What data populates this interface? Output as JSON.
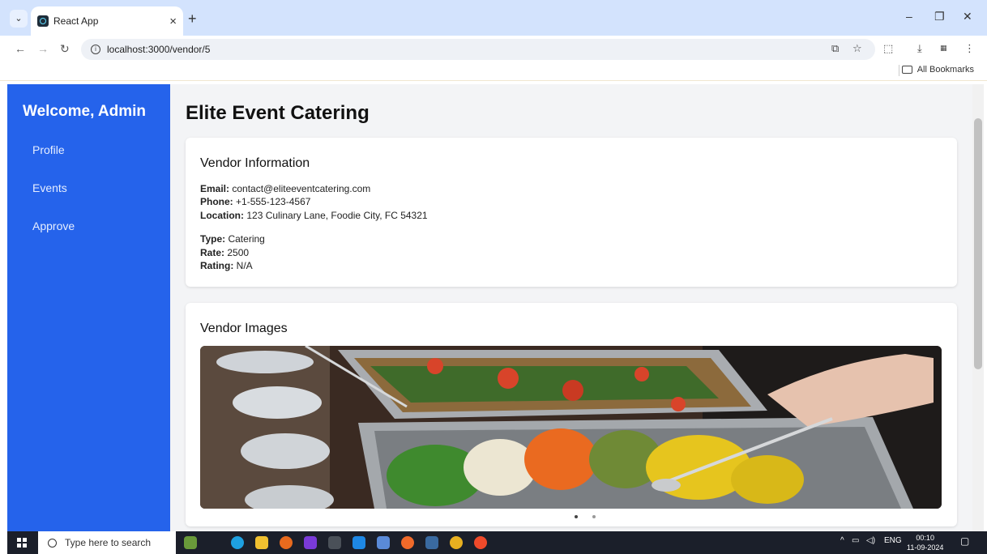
{
  "browser": {
    "tab_title": "React App",
    "url": "localhost:3000/vendor/5",
    "bookmarks_label": "All Bookmarks"
  },
  "sidebar": {
    "welcome": "Welcome, Admin",
    "items": [
      {
        "label": "Profile"
      },
      {
        "label": "Events"
      },
      {
        "label": "Approve"
      }
    ]
  },
  "vendor": {
    "name": "Elite Event Catering",
    "info_heading": "Vendor Information",
    "email_label": "Email:",
    "email": "contact@eliteeventcatering.com",
    "phone_label": "Phone:",
    "phone": "+1-555-123-4567",
    "location_label": "Location:",
    "location": "123 Culinary Lane, Foodie City, FC 54321",
    "type_label": "Type:",
    "type": "Catering",
    "rate_label": "Rate:",
    "rate": "2500",
    "rating_label": "Rating:",
    "rating": "N/A",
    "images_heading": "Vendor Images",
    "image_count": 2,
    "active_image": 1
  },
  "taskbar": {
    "search_placeholder": "Type here to search",
    "language": "ENG",
    "time": "00:10",
    "date": "11-09-2024"
  },
  "colors": {
    "sidebar": "#2563eb",
    "chrome_tabs": "#d3e3fd",
    "main_bg": "#f3f4f6"
  }
}
